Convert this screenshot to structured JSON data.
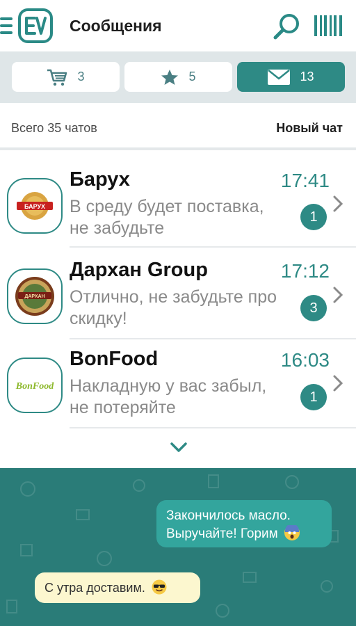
{
  "header": {
    "title": "Сообщения"
  },
  "tabs": [
    {
      "icon": "cart-icon",
      "count": "3",
      "active": false
    },
    {
      "icon": "star-icon",
      "count": "5",
      "active": false
    },
    {
      "icon": "mail-icon",
      "count": "13",
      "active": true
    }
  ],
  "subheader": {
    "total": "Всего 35 чатов",
    "new_chat": "Новый чат"
  },
  "chats": [
    {
      "name": "Барух",
      "time": "17:41",
      "preview": "В среду будет поставка, не забудьте",
      "unread": "1",
      "logo_text": "БАРУХ"
    },
    {
      "name": "Дархан Group",
      "time": "17:12",
      "preview": "Отлично, не забудьте про скидку!",
      "unread": "3",
      "logo_text": "ДАРХАН"
    },
    {
      "name": "BonFood",
      "time": "16:03",
      "preview": "Накладную у вас забыл, не потеряйте",
      "unread": "1",
      "logo_text": "BonFood"
    }
  ],
  "conversation": {
    "outgoing": "Закончилось масло. Выручайте! Горим",
    "incoming": "С утра доставим."
  },
  "colors": {
    "accent": "#2e8a85",
    "chat_bg": "#2a7c78",
    "bubble_out": "#33a59d",
    "bubble_in": "#fcf7cf"
  }
}
